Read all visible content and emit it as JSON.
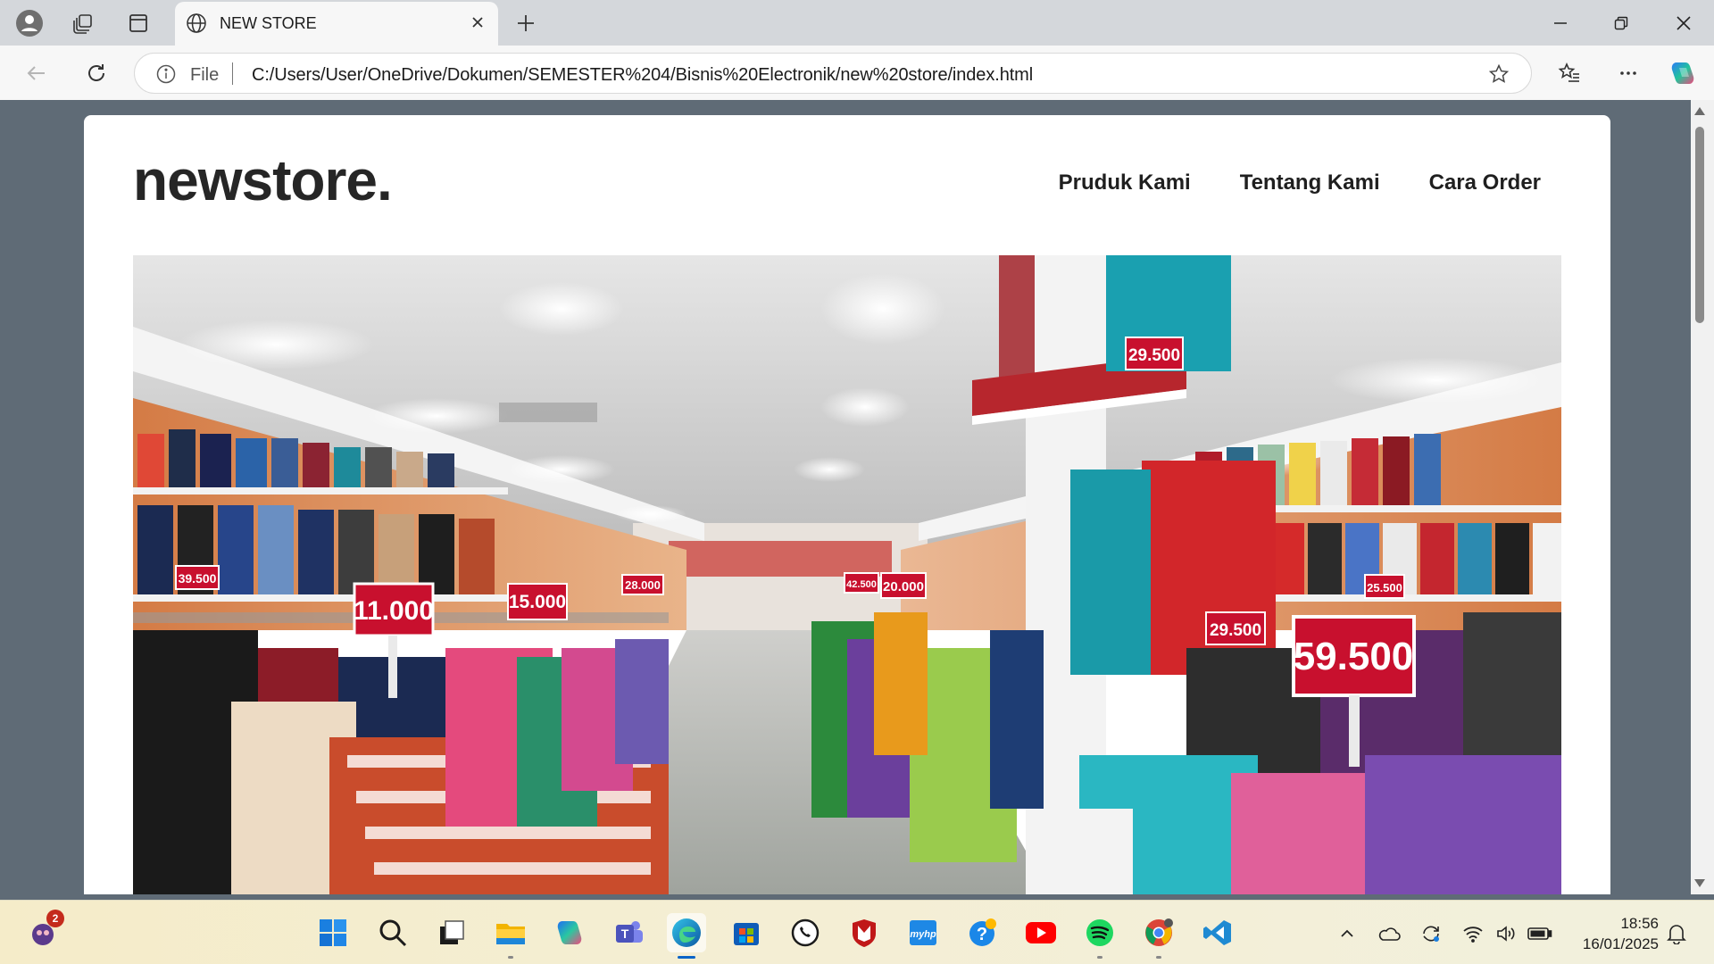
{
  "browser": {
    "tab_title": "NEW STORE",
    "url_scheme": "File",
    "url": "C:/Users/User/OneDrive/Dokumen/SEMESTER%204/Bisnis%20Electronik/new%20store/index.html"
  },
  "page": {
    "brand": "newstore.",
    "nav": [
      "Pruduk Kami",
      "Tentang Kami",
      "Cara Order"
    ],
    "hero": {
      "alt": "store interior photo",
      "price_tags": [
        "11.000",
        "15.000",
        "20.000",
        "29.500",
        "29.500",
        "59.500",
        "39.500",
        "28.000",
        "25.500",
        "42.500"
      ]
    }
  },
  "taskbar": {
    "notification_count": "2",
    "clock_time": "18:56",
    "clock_date": "16/01/2025",
    "apps": [
      "start-icon",
      "search-icon",
      "task-view-icon",
      "file-explorer-icon",
      "copilot-icon",
      "teams-icon",
      "edge-icon",
      "store-icon",
      "whatsapp-icon",
      "mcafee-icon",
      "myhp-icon",
      "get-help-icon",
      "youtube-icon",
      "spotify-icon",
      "chrome-icon",
      "vscode-icon"
    ]
  },
  "colors": {
    "page_bg": "#5f6b76",
    "card_bg": "#ffffff",
    "text_dark": "#262626",
    "accent": "#0a64c8"
  }
}
